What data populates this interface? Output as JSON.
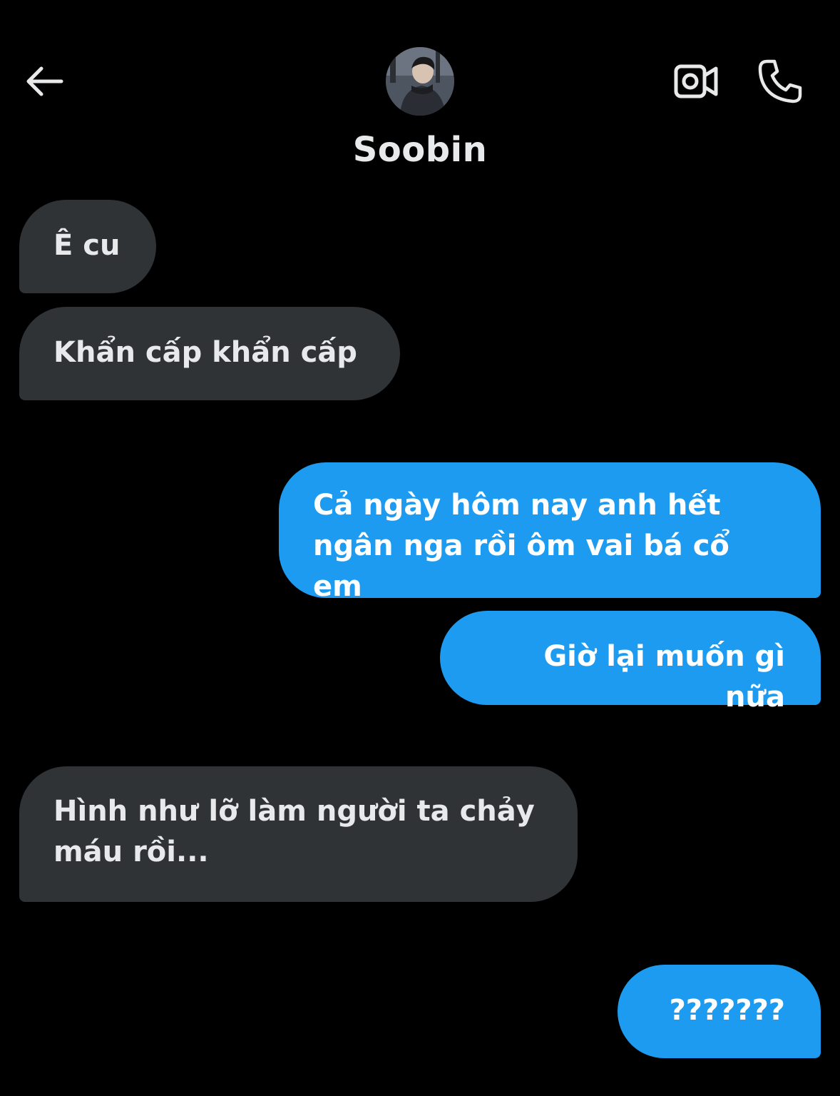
{
  "header": {
    "contact_name": "Soobin",
    "back_icon": "arrow-left-icon",
    "video_icon": "video-camera-icon",
    "call_icon": "phone-icon"
  },
  "messages": [
    {
      "direction": "incoming",
      "text": "Ê cu"
    },
    {
      "direction": "incoming",
      "text": "Khẩn cấp khẩn cấp"
    },
    {
      "direction": "outgoing",
      "text": "Cả ngày hôm nay anh hết\nngân nga rồi ôm vai bá cổ em"
    },
    {
      "direction": "outgoing",
      "text": "Giờ lại muốn gì nữa"
    },
    {
      "direction": "incoming",
      "text": "Hình như lỡ làm người ta chảy\nmáu rồi..."
    },
    {
      "direction": "outgoing",
      "text": "???????"
    }
  ],
  "colors": {
    "background": "#000000",
    "incoming_bubble": "#2f3336",
    "outgoing_bubble": "#1d9bf0",
    "text": "#e7e9ea"
  }
}
